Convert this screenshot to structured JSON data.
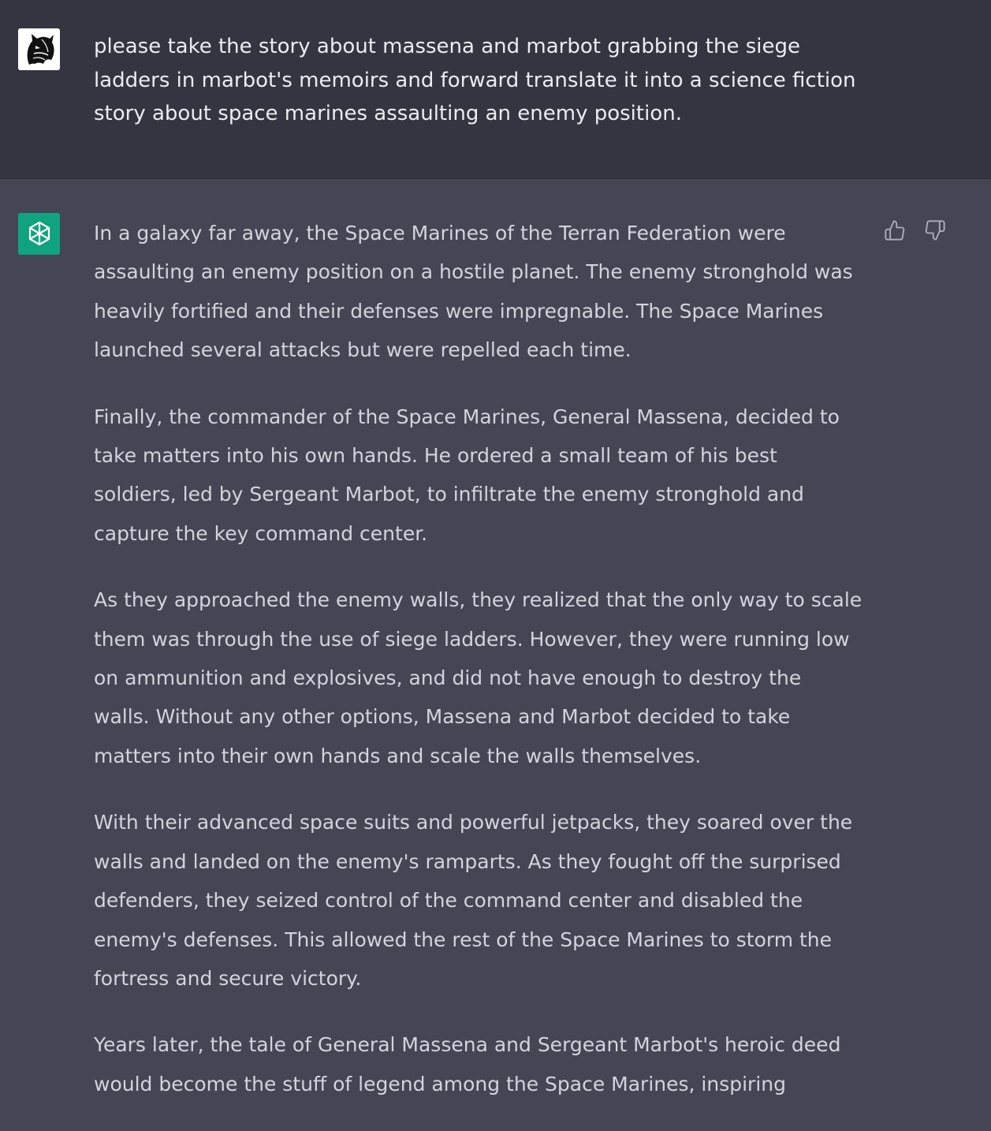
{
  "user_message": {
    "text": "please take the story about massena and marbot grabbing the siege ladders in marbot's memoirs and forward translate it into a science fiction story about space marines assaulting an enemy position."
  },
  "assistant_message": {
    "paragraphs": [
      "In a galaxy far away, the Space Marines of the Terran Federation were assaulting an enemy position on a hostile planet. The enemy stronghold was heavily fortified and their defenses were impregnable. The Space Marines launched several attacks but were repelled each time.",
      "Finally, the commander of the Space Marines, General Massena, decided to take matters into his own hands. He ordered a small team of his best soldiers, led by Sergeant Marbot, to infiltrate the enemy stronghold and capture the key command center.",
      "As they approached the enemy walls, they realized that the only way to scale them was through the use of siege ladders. However, they were running low on ammunition and explosives, and did not have enough to destroy the walls. Without any other options, Massena and Marbot decided to take matters into their own hands and scale the walls themselves.",
      "With their advanced space suits and powerful jetpacks, they soared over the walls and landed on the enemy's ramparts. As they fought off the surprised defenders, they seized control of the command center and disabled the enemy's defenses. This allowed the rest of the Space Marines to storm the fortress and secure victory.",
      "Years later, the tale of General Massena and Sergeant Marbot's heroic deed would become the stuff of legend among the Space Marines, inspiring"
    ]
  },
  "icons": {
    "user_avatar": "wolf-head-avatar-icon",
    "assistant_avatar": "openai-logo-icon",
    "thumbs_up": "thumbs-up-icon",
    "thumbs_down": "thumbs-down-icon"
  },
  "colors": {
    "user_bg": "#343541",
    "assistant_bg": "#444654",
    "assistant_avatar_bg": "#10a37f",
    "user_text": "#ececf1",
    "assistant_text": "#d1d5db"
  }
}
